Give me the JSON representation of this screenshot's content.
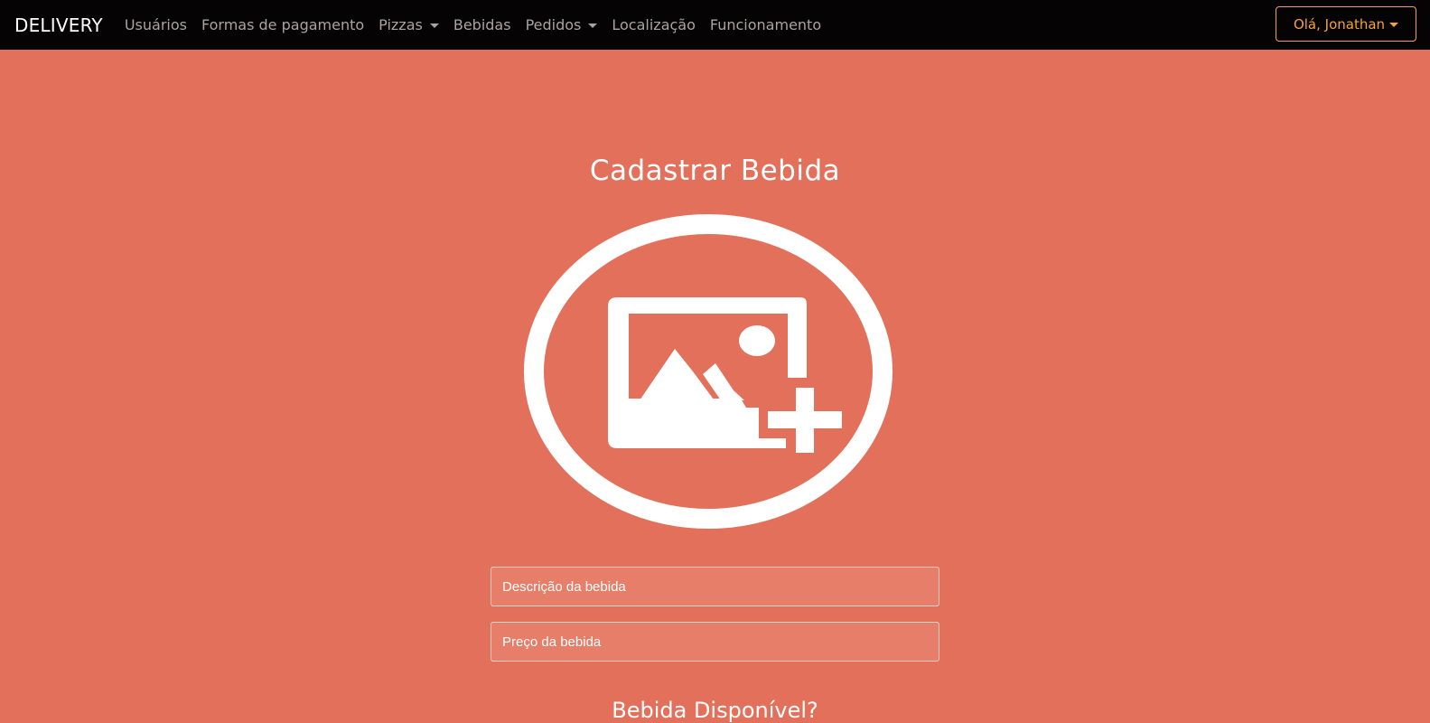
{
  "navbar": {
    "brand": "DELIVERY",
    "links": [
      {
        "label": "Usuários",
        "dropdown": false
      },
      {
        "label": "Formas de pagamento",
        "dropdown": false
      },
      {
        "label": "Pizzas",
        "dropdown": true
      },
      {
        "label": "Bebidas",
        "dropdown": false
      },
      {
        "label": "Pedidos",
        "dropdown": true
      },
      {
        "label": "Localização",
        "dropdown": false
      },
      {
        "label": "Funcionamento",
        "dropdown": false
      }
    ],
    "user_menu": "Olá, Jonathan"
  },
  "page": {
    "title": "Cadastrar Bebida",
    "image_icon": "add-image-icon",
    "description_placeholder": "Descrição da bebida",
    "price_placeholder": "Preço da bebida",
    "available_label": "Bebida Disponível?"
  },
  "colors": {
    "background": "#e2705a",
    "navbar": "#050303",
    "accent": "#f3a33a",
    "text": "#ffffff"
  }
}
